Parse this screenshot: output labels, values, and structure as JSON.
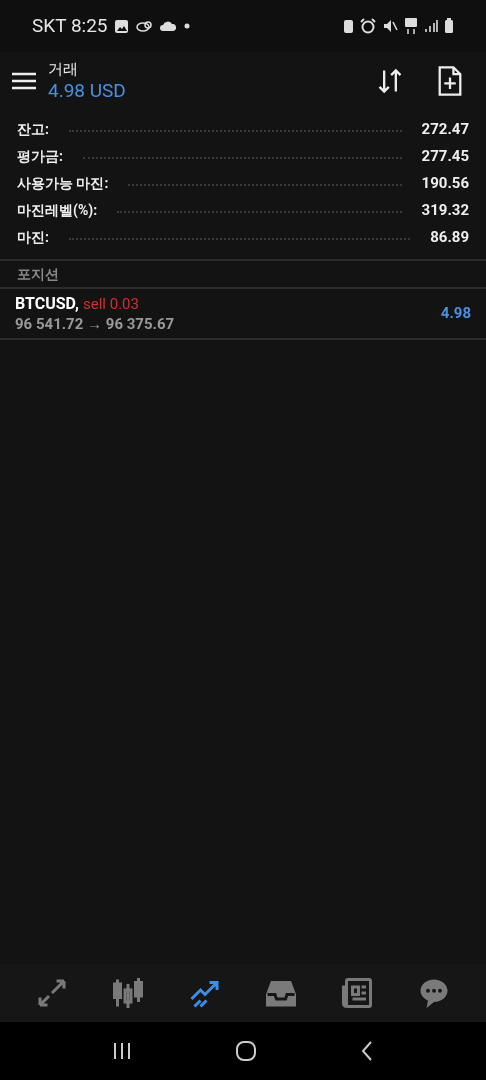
{
  "status_bar": {
    "carrier": "SKT",
    "time": "8:25"
  },
  "header": {
    "title": "거래",
    "profit": "4.98 USD"
  },
  "summary": [
    {
      "label": "잔고:",
      "value": "272.47"
    },
    {
      "label": "평가금:",
      "value": "277.45"
    },
    {
      "label": "사용가능 마진:",
      "value": "190.56"
    },
    {
      "label": "마진레벨(%):",
      "value": "319.32"
    },
    {
      "label": "마진:",
      "value": "86.89"
    }
  ],
  "positions_heading": "포지션",
  "positions": [
    {
      "symbol": "BTCUSD,",
      "side": "sell 0.03",
      "prices": "96 541.72 → 96 375.67",
      "profit": "4.98"
    }
  ],
  "bottom_nav": [
    {
      "kind": "quotes",
      "selected": false
    },
    {
      "kind": "chart",
      "selected": false
    },
    {
      "kind": "trade",
      "selected": true
    },
    {
      "kind": "history",
      "selected": false
    },
    {
      "kind": "news",
      "selected": false
    },
    {
      "kind": "chat",
      "selected": false
    }
  ]
}
